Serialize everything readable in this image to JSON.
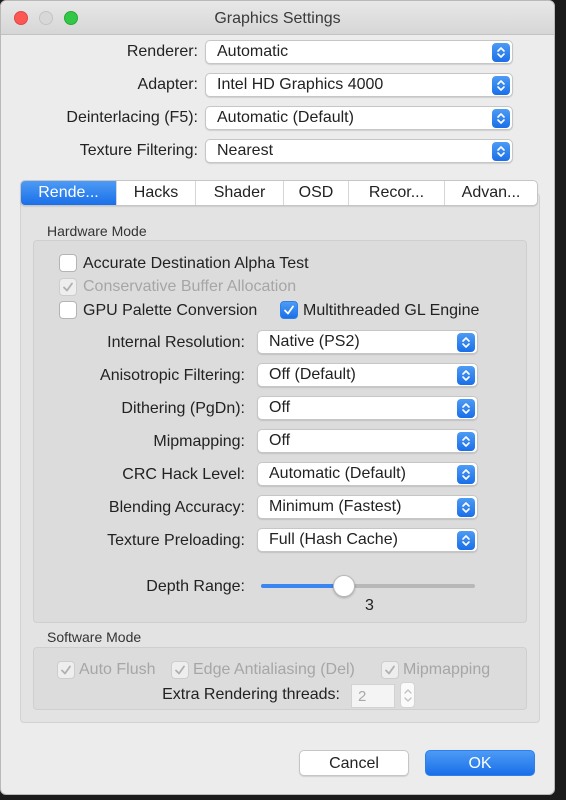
{
  "window": {
    "title": "Graphics Settings"
  },
  "top_fields": [
    {
      "label": "Renderer:",
      "value": "Automatic"
    },
    {
      "label": "Adapter:",
      "value": "Intel HD Graphics 4000"
    },
    {
      "label": "Deinterlacing (F5):",
      "value": "Automatic (Default)"
    },
    {
      "label": "Texture Filtering:",
      "value": "Nearest"
    }
  ],
  "tabs": [
    "Rende...",
    "Hacks",
    "Shader",
    "OSD",
    "Recor...",
    "Advan..."
  ],
  "active_tab": "Rende...",
  "hardware": {
    "title": "Hardware Mode",
    "checks": [
      {
        "label": "Accurate Destination Alpha Test",
        "checked": false,
        "enabled": true
      },
      {
        "label": "Conservative Buffer Allocation",
        "checked": true,
        "enabled": false
      },
      {
        "label": "GPU Palette Conversion",
        "checked": false,
        "enabled": true
      },
      {
        "label": "Multithreaded GL Engine",
        "checked": true,
        "enabled": true
      }
    ],
    "fields": [
      {
        "label": "Internal Resolution:",
        "value": "Native (PS2)"
      },
      {
        "label": "Anisotropic Filtering:",
        "value": "Off (Default)"
      },
      {
        "label": "Dithering (PgDn):",
        "value": "Off"
      },
      {
        "label": "Mipmapping:",
        "value": "Off"
      },
      {
        "label": "CRC Hack Level:",
        "value": "Automatic (Default)"
      },
      {
        "label": "Blending Accuracy:",
        "value": "Minimum (Fastest)"
      },
      {
        "label": "Texture Preloading:",
        "value": "Full (Hash Cache)"
      }
    ],
    "depth_range": {
      "label": "Depth Range:",
      "value": "3",
      "fraction": 0.39
    }
  },
  "software": {
    "title": "Software Mode",
    "checks": [
      {
        "label": "Auto Flush",
        "checked": true,
        "enabled": false
      },
      {
        "label": "Edge Antialiasing (Del)",
        "checked": true,
        "enabled": false
      },
      {
        "label": "Mipmapping",
        "checked": true,
        "enabled": false
      }
    ],
    "threads": {
      "label": "Extra Rendering threads:",
      "value": "2"
    }
  },
  "buttons": {
    "cancel": "Cancel",
    "ok": "OK"
  },
  "colors": {
    "accent": "#1a6fe8",
    "close": "#fc5753",
    "maximize": "#33c748"
  }
}
